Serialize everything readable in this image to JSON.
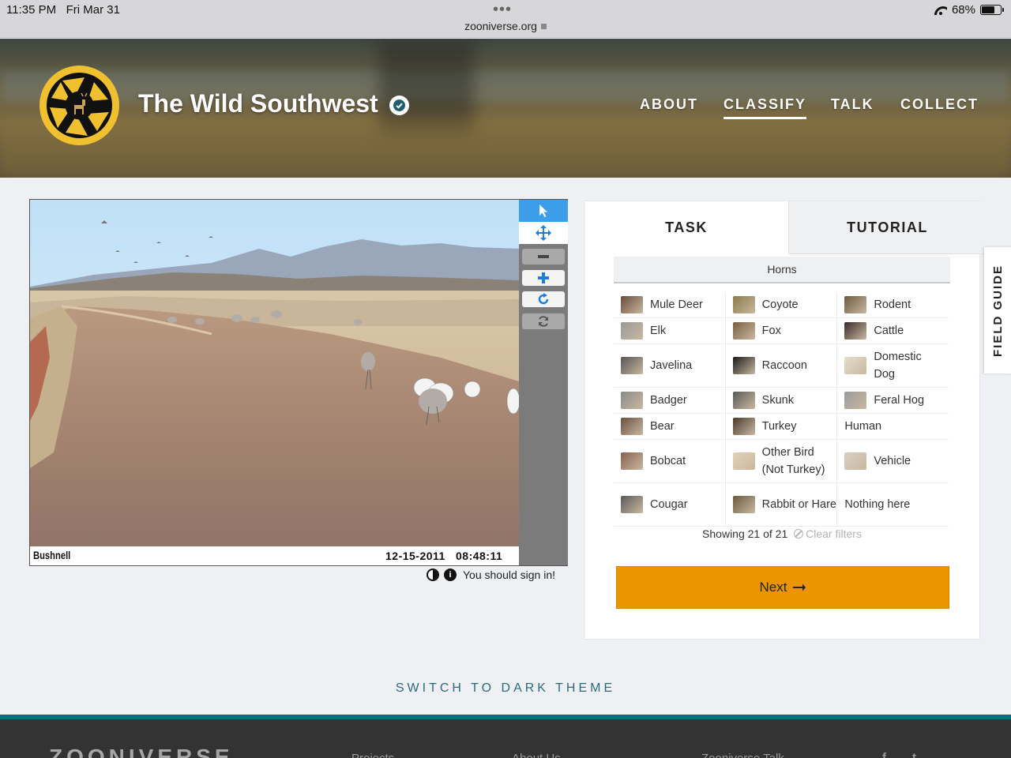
{
  "status_bar": {
    "time": "11:35 PM",
    "date": "Fri Mar 31",
    "url": "zooniverse.org",
    "battery": "68%",
    "battery_level": 0.68
  },
  "project": {
    "title": "The Wild Southwest"
  },
  "nav": {
    "about": "ABOUT",
    "classify": "CLASSIFY",
    "talk": "TALK",
    "collect": "COLLECT"
  },
  "viewer": {
    "camera_brand": "Bushnell",
    "date": "12-15-2011",
    "time": "08:48:11",
    "signin_message": "You should sign in!"
  },
  "task_panel": {
    "tabs": {
      "task": "TASK",
      "tutorial": "TUTORIAL"
    },
    "filter_label": "Horns",
    "species": [
      [
        "Mule Deer",
        "Coyote",
        "Rodent"
      ],
      [
        "Elk",
        "Fox",
        "Cattle"
      ],
      [
        "Javelina",
        "Raccoon",
        "Domestic Dog"
      ],
      [
        "Badger",
        "Skunk",
        "Feral Hog"
      ],
      [
        "Bear",
        "Turkey",
        "Human"
      ],
      [
        "Bobcat",
        "Other Bird (Not Turkey)",
        "Vehicle"
      ],
      [
        "Cougar",
        "Rabbit or Hare",
        "Nothing here"
      ]
    ],
    "showing": "Showing 21 of 21",
    "clear_filters": "Clear filters",
    "next": "Next"
  },
  "field_guide": "FIELD GUIDE",
  "dark_theme": "SWITCH TO DARK THEME",
  "footer": {
    "brand": "ZOONIVERSE",
    "links": [
      "Projects",
      "About Us",
      "Zooniverse Talk"
    ],
    "social": [
      "f",
      "t"
    ]
  },
  "colors": {
    "accent": "#ec9500",
    "header_link": "#ffffff",
    "teal": "#00707a",
    "tool_active": "#3c9ee8"
  }
}
